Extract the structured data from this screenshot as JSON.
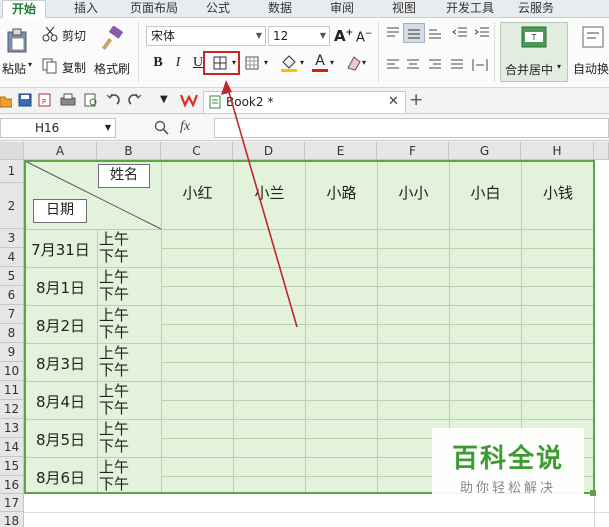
{
  "tabs": [
    "开始",
    "插入",
    "页面布局",
    "公式",
    "数据",
    "审阅",
    "视图",
    "开发工具",
    "云服务"
  ],
  "ribbon": {
    "paste_label": "粘贴",
    "cut_label": "剪切",
    "copy_label": "复制",
    "format_painter_label": "格式刷",
    "font_name": "宋体",
    "font_size": "12",
    "merge_center_label": "合并居中",
    "wrap_label": "自动换"
  },
  "quick_access": {
    "doc_tab_label": "Book2 *"
  },
  "formula_bar": {
    "name_box": "H16",
    "fx_label": "fx",
    "formula": ""
  },
  "sheet": {
    "columns": [
      "A",
      "B",
      "C",
      "D",
      "E",
      "F",
      "G",
      "H"
    ],
    "rows": [
      "1",
      "2",
      "3",
      "4",
      "5",
      "6",
      "7",
      "8",
      "9",
      "10",
      "11",
      "12",
      "13",
      "14",
      "15",
      "16",
      "17",
      "18"
    ],
    "header_name_label": "姓名",
    "header_date_label": "日期",
    "names": [
      "小红",
      "小兰",
      "小路",
      "小小",
      "小白",
      "小钱"
    ],
    "dates": [
      "7月31日",
      "8月1日",
      "8月2日",
      "8月3日",
      "8月4日",
      "8月5日",
      "8月6日"
    ],
    "am_label": "上午",
    "pm_label": "下午"
  },
  "watermark": {
    "title": "百科全说",
    "subtitle": "助你轻松解决"
  },
  "colors": {
    "accent": "#1a7f2f",
    "table_fill": "#e3f2da",
    "table_border": "#5ea54a",
    "annotation": "#c0282d"
  }
}
